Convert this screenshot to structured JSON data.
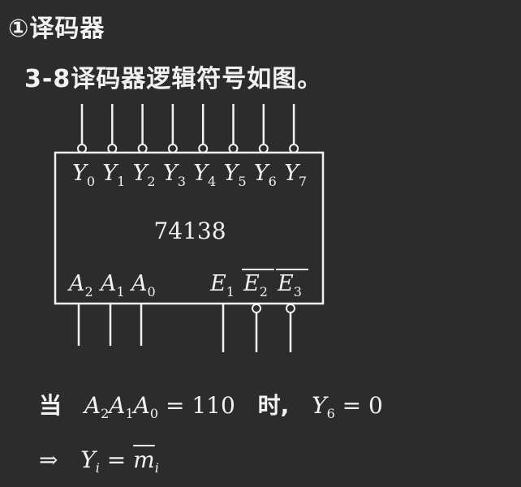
{
  "heading": "①译码器",
  "subtitle": "3-8译码器逻辑符号如图。",
  "chip": {
    "name": "74138",
    "outputs": [
      {
        "base": "Y",
        "sub": "0"
      },
      {
        "base": "Y",
        "sub": "1"
      },
      {
        "base": "Y",
        "sub": "2"
      },
      {
        "base": "Y",
        "sub": "3"
      },
      {
        "base": "Y",
        "sub": "4"
      },
      {
        "base": "Y",
        "sub": "5"
      },
      {
        "base": "Y",
        "sub": "6"
      },
      {
        "base": "Y",
        "sub": "7"
      }
    ],
    "address_inputs": [
      {
        "base": "A",
        "sub": "2"
      },
      {
        "base": "A",
        "sub": "1"
      },
      {
        "base": "A",
        "sub": "0"
      }
    ],
    "enable_inputs": [
      {
        "base": "E",
        "sub": "1",
        "active_low": false
      },
      {
        "base": "E",
        "sub": "2",
        "active_low": true
      },
      {
        "base": "E",
        "sub": "3",
        "active_low": true
      }
    ]
  },
  "statement1": {
    "prefix": "当",
    "lhs": [
      {
        "base": "A",
        "sub": "2"
      },
      {
        "base": "A",
        "sub": "1"
      },
      {
        "base": "A",
        "sub": "0"
      }
    ],
    "eq1": "= 110",
    "mid": "时,",
    "out_base": "Y",
    "out_sub": "6",
    "eq2": "= 0"
  },
  "statement2": {
    "arrow": "⇒",
    "lhs_base": "Y",
    "lhs_sub": "i",
    "eq": "=",
    "rhs_base": "m",
    "rhs_sub": "i"
  },
  "colors": {
    "background": "#2c2c2c",
    "ink": "#f2f2f2"
  }
}
